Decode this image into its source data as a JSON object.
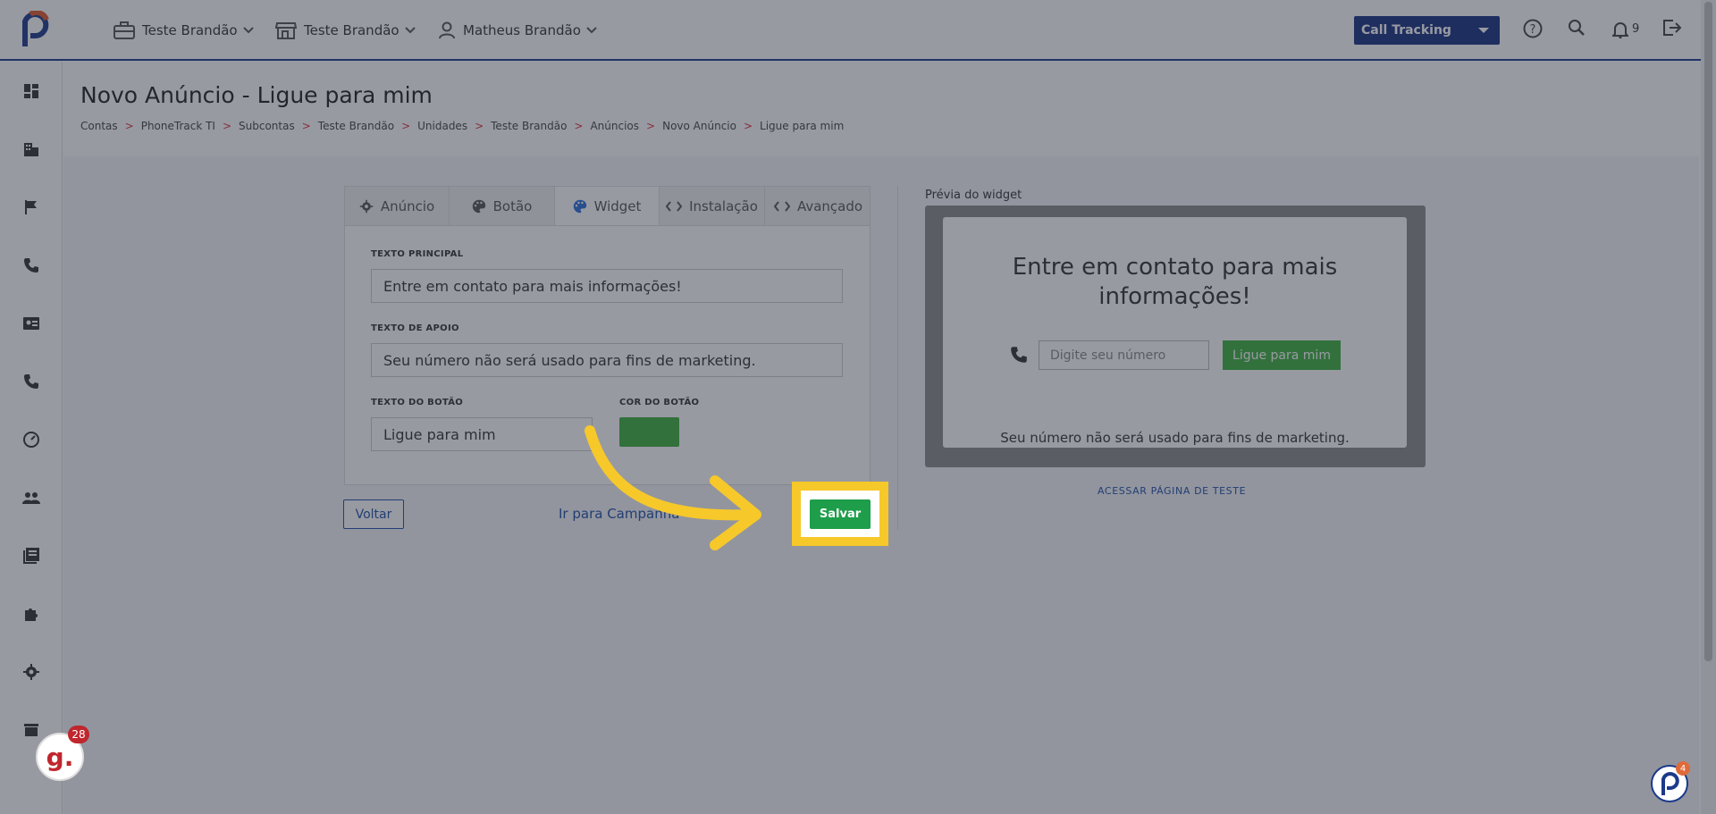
{
  "topbar": {
    "account_label": "Teste Brandão",
    "store_label": "Teste Brandão",
    "user_label": "Matheus Brandão",
    "product_select": "Call Tracking",
    "notification_count": "9"
  },
  "page": {
    "title": "Novo Anúncio - Ligue para mim",
    "breadcrumb": [
      "Contas",
      "PhoneTrack TI",
      "Subcontas",
      "Teste Brandão",
      "Unidades",
      "Teste Brandão",
      "Anúncios",
      "Novo Anúncio",
      "Ligue para mim"
    ],
    "breadcrumb_sep": ">"
  },
  "tabs": [
    "Anúncio",
    "Botão",
    "Widget",
    "Instalação",
    "Avançado"
  ],
  "form": {
    "main_text_label": "TEXTO PRINCIPAL",
    "main_text_value": "Entre em contato para mais informações!",
    "support_text_label": "TEXTO DE APOIO",
    "support_text_value": "Seu número não será usado para fins de marketing.",
    "button_text_label": "TEXTO DO BOTÃO",
    "button_text_value": "Ligue para mim",
    "button_color_label": "COR DO BOTÃO",
    "button_color": "#3cb03c"
  },
  "actions": {
    "back": "Voltar",
    "campaign_link": "Ir para Campanha",
    "save": "Salvar"
  },
  "preview": {
    "label": "Prévia do widget",
    "title": "Entre em contato para mais informações!",
    "phone_placeholder": "Digite seu número",
    "button": "Ligue para mim",
    "support": "Seu número não será usado para fins de marketing.",
    "test_link": "ACESSAR PÁGINA DE TESTE"
  },
  "badges": {
    "g_letter": "g.",
    "g_count": "28",
    "p_count": "4"
  },
  "colors": {
    "brand": "#16307f",
    "save_green": "#1e9e4a",
    "highlight": "#f6c82a",
    "breadcrumb_sep": "#dd3333"
  }
}
